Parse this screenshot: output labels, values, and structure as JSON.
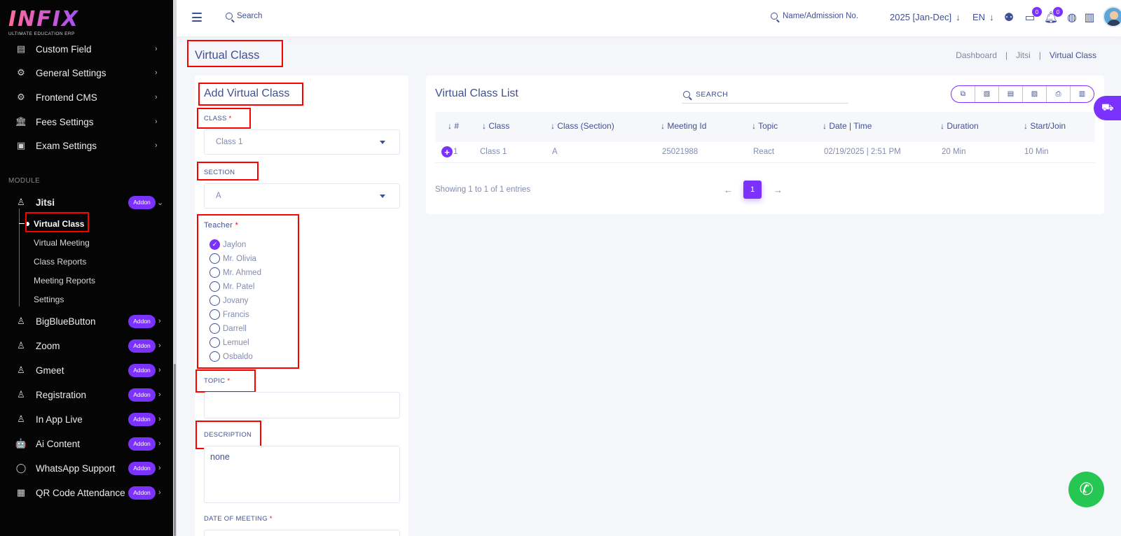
{
  "brand": {
    "name": "INFIX",
    "tagline": "ULTIMATE EDUCATION ERP"
  },
  "sidebar": {
    "items_top": [
      {
        "label": "Custom Field",
        "icon": "custom-field-icon"
      },
      {
        "label": "General Settings",
        "icon": "gears-icon"
      },
      {
        "label": "Frontend CMS",
        "icon": "cms-icon"
      },
      {
        "label": "Fees Settings",
        "icon": "bank-icon"
      },
      {
        "label": "Exam Settings",
        "icon": "book-icon"
      }
    ],
    "module_label": "MODULE",
    "jitsi": {
      "label": "Jitsi",
      "badge": "Addon"
    },
    "jitsi_sub": [
      "Virtual Class",
      "Virtual Meeting",
      "Class Reports",
      "Meeting Reports",
      "Settings"
    ],
    "modules": [
      {
        "label": "BigBlueButton",
        "badge": "Addon"
      },
      {
        "label": "Zoom",
        "badge": "Addon"
      },
      {
        "label": "Gmeet",
        "badge": "Addon"
      },
      {
        "label": "Registration",
        "badge": "Addon"
      },
      {
        "label": "In App Live",
        "badge": "Addon"
      },
      {
        "label": "Ai Content",
        "badge": "Addon"
      },
      {
        "label": "WhatsApp Support",
        "badge": "Addon"
      },
      {
        "label": "QR Code Attendance",
        "badge": "Addon"
      }
    ]
  },
  "header": {
    "search_label": "Search",
    "admission_search": "Name/Admission No.",
    "year": "2025 [Jan-Dec]",
    "lang": "EN",
    "chat_count": "0",
    "notif_count": "0"
  },
  "page": {
    "title": "Virtual Class",
    "breadcrumb": [
      "Dashboard",
      "Jitsi",
      "Virtual Class"
    ]
  },
  "form": {
    "title": "Add Virtual Class",
    "class_label": "CLASS",
    "class_value": "Class 1",
    "section_label": "SECTION",
    "section_value": "A",
    "teacher_label": "Teacher",
    "teachers": [
      "Jaylon",
      "Mr. Olivia",
      "Mr. Ahmed",
      "Mr. Patel",
      "Jovany",
      "Francis",
      "Darrell",
      "Lemuel",
      "Osbaldo"
    ],
    "teacher_selected": "Jaylon",
    "topic_label": "TOPIC",
    "topic_value": "",
    "description_label": "DESCRIPTION",
    "description_value": "none",
    "date_label": "DATE OF MEETING",
    "required_mark": "*"
  },
  "list": {
    "title": "Virtual Class List",
    "search_placeholder": "SEARCH",
    "export_icons": [
      "copy-icon",
      "excel-icon",
      "csv-icon",
      "pdf-icon",
      "print-icon",
      "columns-icon"
    ],
    "columns": [
      "#",
      "Class",
      "Class (Section)",
      "Meeting Id",
      "Topic",
      "Date | Time",
      "Duration",
      "Start/Join"
    ],
    "rows": [
      {
        "no": "1",
        "class": "Class 1",
        "section": "A",
        "meeting_id": "25021988",
        "topic": "React",
        "datetime": "02/19/2025 | 2:51 PM",
        "duration": "20 Min",
        "start_join": "10 Min"
      }
    ],
    "showing": "Showing 1 to 1 of 1 entries",
    "current_page": "1"
  },
  "colors": {
    "accent": "#7c32ff",
    "text": "#415094",
    "annotation": "#ff0000",
    "whatsapp": "#25c652"
  }
}
